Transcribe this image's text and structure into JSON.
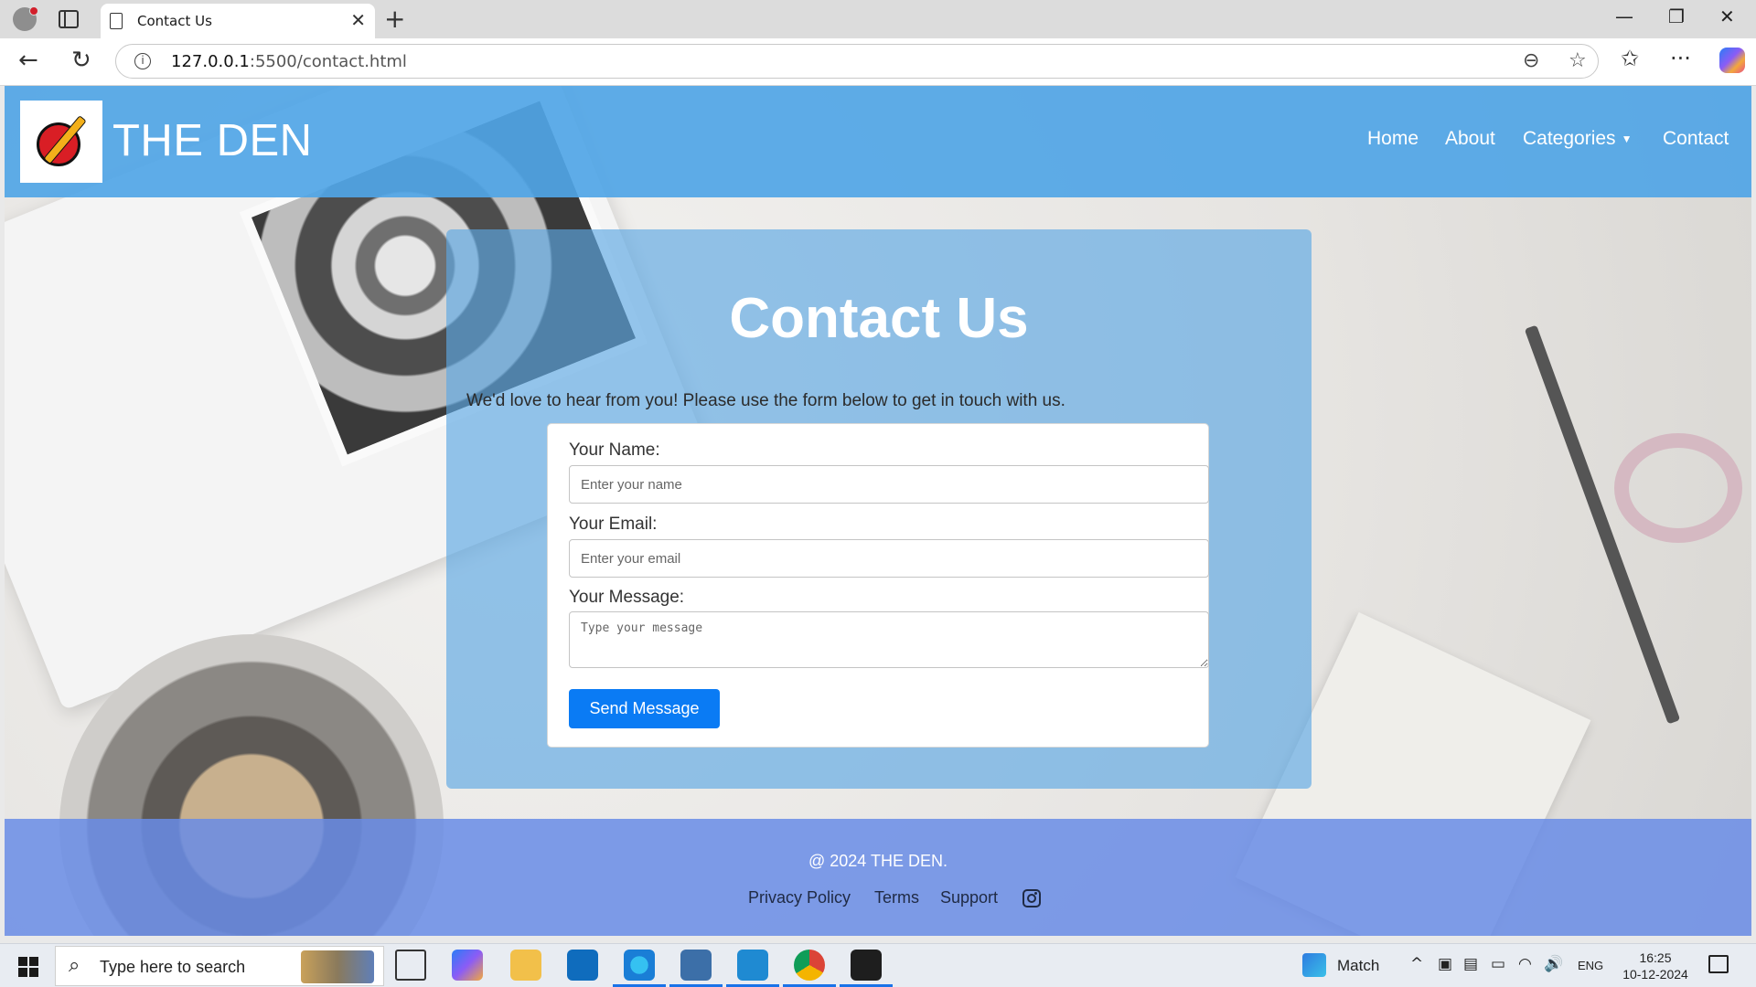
{
  "browser": {
    "tab_title": "Contact Us",
    "tab_close": "✕",
    "new_tab": "+",
    "url_host": "127.0.0.1",
    "url_path": ":5500/contact.html",
    "window_controls": {
      "minimize": "—",
      "maximize": "❐",
      "close": "✕"
    },
    "nav": {
      "back": "←",
      "refresh": "↻"
    },
    "info": "i",
    "zoom_icon": "⊖",
    "favorite_icon": "☆",
    "favorites_icon": "✩",
    "more_icon": "···"
  },
  "site": {
    "title": "THE DEN",
    "nav": [
      {
        "label": "Home"
      },
      {
        "label": "About"
      },
      {
        "label": "Categories",
        "caret": "▼"
      },
      {
        "label": "Contact"
      }
    ]
  },
  "contact": {
    "heading": "Contact Us",
    "intro": "We'd love to hear from you! Please use the form below to get in touch with us.",
    "name_label": "Your Name:",
    "name_placeholder": "Enter your name",
    "email_label": "Your Email:",
    "email_placeholder": "Enter your email",
    "message_label": "Your Message:",
    "message_placeholder": "Type your message",
    "submit_label": "Send Message"
  },
  "footer": {
    "copyright": "@ 2024 THE DEN.",
    "links": [
      "Privacy Policy",
      "Terms",
      "Support"
    ]
  },
  "taskbar": {
    "search_placeholder": "Type here to search",
    "search_icon": "⌕",
    "weather_label": "Match",
    "language": "ENG",
    "time": "16:25",
    "date": "10-12-2024",
    "tray_icons": [
      "^",
      "▣",
      "▤",
      "▭",
      "◠",
      "🔊"
    ]
  },
  "colors": {
    "header": "#50a5e6",
    "panel": "#5ca8e4",
    "footer": "#698ce6",
    "button": "#0a7bf4"
  }
}
